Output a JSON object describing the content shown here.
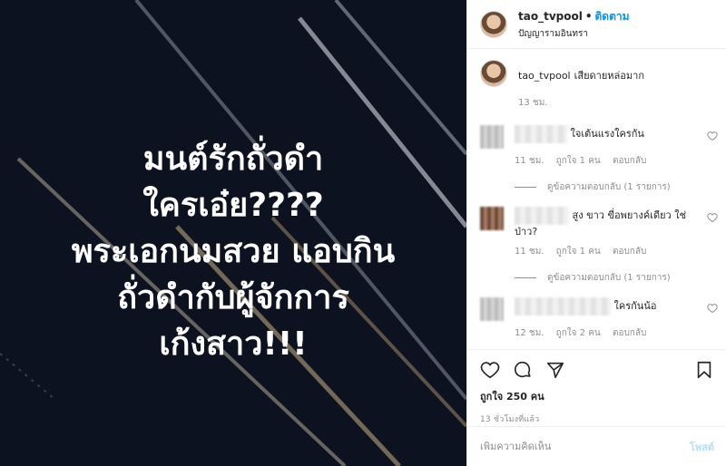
{
  "image": {
    "overlay_lines": [
      "มนต์รักถั่วดำ",
      "ใครเอ๋ย????",
      "พระเอกนมสวย แอบกิน",
      "ถั่วดำกับผู้จักการ",
      "เก้งสาว!!!"
    ]
  },
  "header": {
    "username": "tao_tvpool",
    "dot": "•",
    "follow": "ติดตาม",
    "location": "ปัญญารามอินทรา"
  },
  "caption": {
    "username": "tao_tvpool",
    "text": "เสียดายหล่อมาก",
    "time": "13 ชม."
  },
  "comments": [
    {
      "text": "ใจเต้นแรงใครกัน",
      "time": "11 ชม.",
      "likes": "ถูกใจ 1 คน",
      "reply": "ตอบกลับ",
      "view_replies": "ดูข้อความตอบกลับ (1 รายการ)"
    },
    {
      "text": "สูง ขาว ขี่อพยางค์เดียว ใช่ป่าว?",
      "time": "11 ชม.",
      "likes": "ถูกใจ 1 คน",
      "reply": "ตอบกลับ",
      "view_replies": "ดูข้อความตอบกลับ (1 รายการ)"
    },
    {
      "text": "ใครกันน้อ",
      "time": "12 ชม.",
      "likes": "ถูกใจ 2 คน",
      "reply": "ตอบกลับ"
    }
  ],
  "actions": {
    "likes": "ถูกใจ 250 คน",
    "timestamp": "13 ชั่วโมงที่แล้ว"
  },
  "add_comment": {
    "placeholder": "เพิ่มความคิดเห็น",
    "post": "โพสต์"
  },
  "colors": {
    "accent": "#0095f6",
    "muted": "#8e8e8e",
    "image_bg": "#0c1220"
  }
}
